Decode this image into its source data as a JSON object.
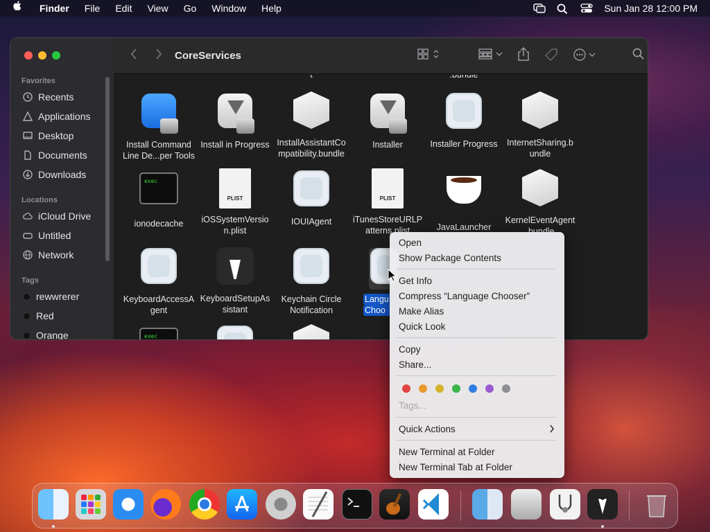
{
  "menubar": {
    "app": "Finder",
    "items": [
      "File",
      "Edit",
      "View",
      "Go",
      "Window",
      "Help"
    ],
    "clock": "Sun Jan 28  12:00 PM"
  },
  "window": {
    "title": "CoreServices"
  },
  "sidebar": {
    "favorites_label": "Favorites",
    "favorites": [
      {
        "label": "Recents",
        "icon": "clock-icon"
      },
      {
        "label": "Applications",
        "icon": "applications-icon"
      },
      {
        "label": "Desktop",
        "icon": "desktop-icon"
      },
      {
        "label": "Documents",
        "icon": "document-icon"
      },
      {
        "label": "Downloads",
        "icon": "download-icon"
      }
    ],
    "locations_label": "Locations",
    "locations": [
      {
        "label": "iCloud Drive",
        "icon": "cloud-icon"
      },
      {
        "label": "Untitled",
        "icon": "drive-icon"
      },
      {
        "label": "Network",
        "icon": "globe-icon"
      }
    ],
    "tags_label": "Tags",
    "tags": [
      {
        "label": "rewwrerer",
        "color": "#111111"
      },
      {
        "label": "Red",
        "color": "#111111"
      },
      {
        "label": "Orange",
        "color": "#111111"
      }
    ]
  },
  "files": {
    "partial_top": [
      "t",
      ".bundle"
    ],
    "row1": [
      {
        "line1": "Install Command",
        "line2": "Line De...per Tools",
        "icon": "xcode-installer-icon"
      },
      {
        "line1": "Install in Progress",
        "line2": "",
        "icon": "installer-icon"
      },
      {
        "line1": "InstallAssistantCo",
        "line2": "mpatibility.bundle",
        "icon": "bundle-icon"
      },
      {
        "line1": "Installer",
        "line2": "",
        "icon": "installer-icon"
      },
      {
        "line1": "Installer Progress",
        "line2": "",
        "icon": "app-placeholder-icon"
      },
      {
        "line1": "InternetSharing.b",
        "line2": "undle",
        "icon": "bundle-icon"
      }
    ],
    "row2": [
      {
        "line1": "ionodecache",
        "line2": "",
        "icon": "exec-icon",
        "exec": "exec"
      },
      {
        "line1": "iOSSystemVersio",
        "line2": "n.plist",
        "icon": "plist-icon",
        "badge": "PLIST"
      },
      {
        "line1": "IOUIAgent",
        "line2": "",
        "icon": "app-placeholder-icon"
      },
      {
        "line1": "iTunesStoreURLP",
        "line2": "atterns.plist",
        "icon": "plist-icon",
        "badge": "PLIST"
      },
      {
        "line1": "JavaLauncher",
        "line2": "",
        "icon": "coffee-cup-icon"
      },
      {
        "line1": "KernelEventAgent",
        "line2": ".bundle",
        "icon": "bundle-icon"
      }
    ],
    "row3": [
      {
        "line1": "KeyboardAccessA",
        "line2": "gent",
        "icon": "app-placeholder-icon"
      },
      {
        "line1": "KeyboardSetupAs",
        "line2": "sistant",
        "icon": "tuxedo-icon"
      },
      {
        "line1": "Keychain Circle",
        "line2": "Notification",
        "icon": "app-placeholder-icon"
      },
      {
        "line1": "Langu",
        "line2": "Choo",
        "icon": "app-placeholder-icon"
      }
    ],
    "row4_exec": "exec"
  },
  "context_menu": {
    "open": "Open",
    "show_package": "Show Package Contents",
    "get_info": "Get Info",
    "compress": "Compress “Language Chooser”",
    "make_alias": "Make Alias",
    "quick_look": "Quick Look",
    "copy": "Copy",
    "share": "Share...",
    "tag_colors": [
      "#e0443f",
      "#e89a2b",
      "#d6b327",
      "#3ab54a",
      "#2f7de1",
      "#9b59d0",
      "#8e8e93"
    ],
    "tags": "Tags...",
    "quick_actions": "Quick Actions",
    "new_terminal": "New Terminal at Folder",
    "new_terminal_tab": "New Terminal Tab at Folder"
  },
  "dock": {
    "apps": [
      "finder-icon",
      "launchpad-icon",
      "safari-icon",
      "firefox-icon",
      "chrome-icon",
      "app-store-icon",
      "system-settings-icon",
      "textedit-icon",
      "terminal-icon",
      "garageband-icon",
      "vscode-icon",
      "finder-alt-icon",
      "installer-icon",
      "disk-utility-icon",
      "keyboard-setup-icon",
      "trash-icon"
    ]
  }
}
